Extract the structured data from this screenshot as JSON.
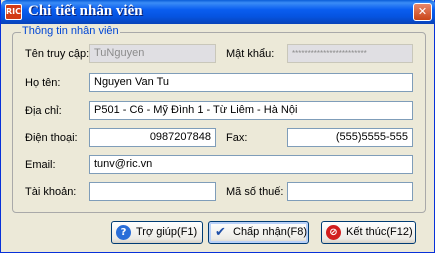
{
  "window": {
    "title": "Chi tiết nhân viên",
    "logo_text": "RIC",
    "close_glyph": "✕"
  },
  "group": {
    "legend": "Thông tin nhân viên"
  },
  "form": {
    "username_label": "Tên truy cập:",
    "username_value": "TuNguyen",
    "password_label": "Mật khẩu:",
    "password_value": "************************",
    "fullname_label": "Họ tên:",
    "fullname_value": "Nguyen Van Tu",
    "address_label": "Địa chỉ:",
    "address_value": "P501 - C6 - Mỹ Đình 1 - Từ Liêm - Hà Nội",
    "phone_label": "Điện thoại:",
    "phone_value": "0987207848",
    "fax_label": "Fax:",
    "fax_value": "(555)5555-555",
    "email_label": "Email:",
    "email_value": "tunv@ric.vn",
    "account_label": "Tài khoản:",
    "account_value": "",
    "tax_label": "Mã số thuế:",
    "tax_value": ""
  },
  "buttons": {
    "help_label": "Trợ giúp(F1)",
    "help_icon": "question-icon",
    "accept_label": "Chấp nhận(F8)",
    "accept_icon": "checkmark-icon",
    "exit_label": "Kết thúc(F12)",
    "exit_icon": "stop-icon"
  },
  "colors": {
    "titlebar": "#0553e0",
    "legend": "#0046d5",
    "help_icon": "#2a6ed8",
    "accept_icon": "#1f4fa8",
    "exit_icon": "#d21f1f"
  }
}
